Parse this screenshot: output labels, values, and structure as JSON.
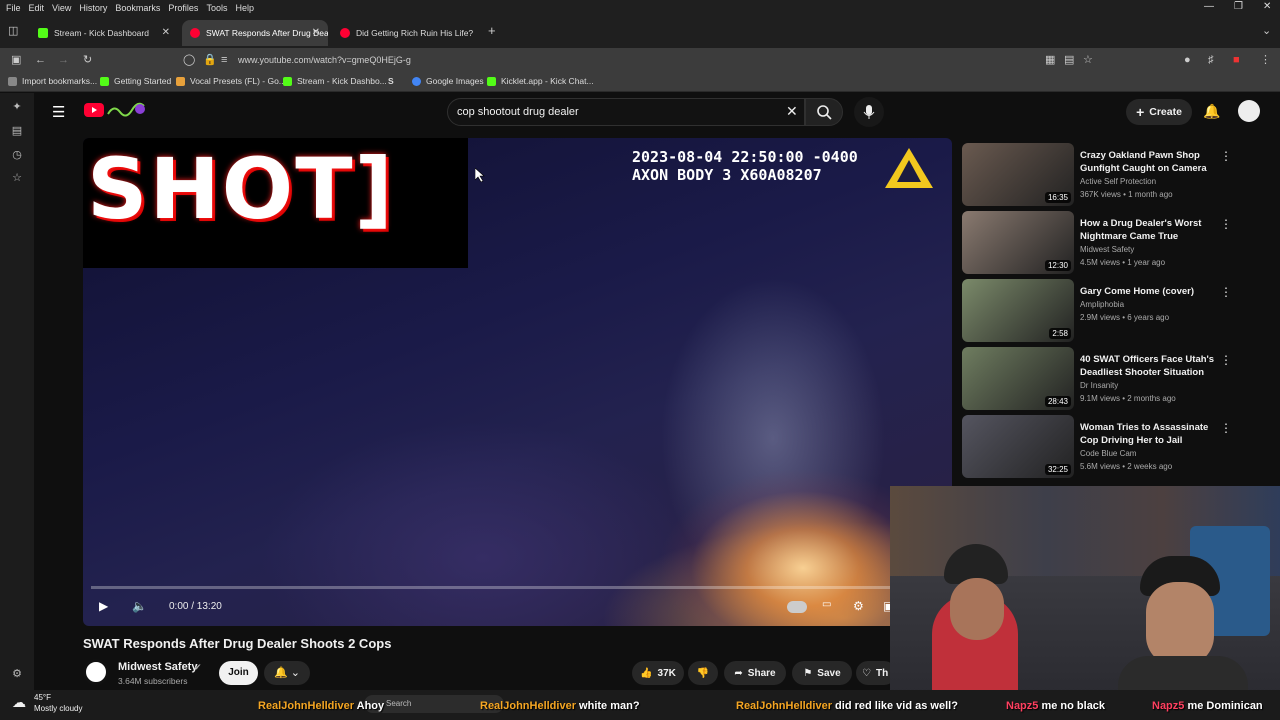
{
  "menubar": [
    "File",
    "Edit",
    "View",
    "History",
    "Bookmarks",
    "Profiles",
    "Tools",
    "Help"
  ],
  "tabs": [
    {
      "label": "Stream - Kick Dashboard",
      "color": "#53fc18"
    },
    {
      "label": "SWAT Responds After Drug Dea",
      "color": "#ff0033"
    },
    {
      "label": "Did Getting Rich Ruin His Life?",
      "color": "#ff0033"
    }
  ],
  "address": {
    "url": "www.youtube.com/watch?v=gmeQ0HEjG-g"
  },
  "bookmarks": [
    {
      "label": "Import bookmarks...",
      "color": "#888"
    },
    {
      "label": "Getting Started",
      "color": "#53fc18"
    },
    {
      "label": "Vocal Presets (FL) - Go...",
      "color": "#e8a13b"
    },
    {
      "label": "Stream - Kick Dashbo...",
      "color": "#53fc18"
    },
    {
      "label": "S",
      "color": "#555"
    },
    {
      "label": "Google Images",
      "color": "#4285f4"
    },
    {
      "label": "Kicklet.app - Kick Chat...",
      "color": "#53fc18"
    }
  ],
  "search": {
    "query": "cop shootout drug dealer"
  },
  "header": {
    "create_label": "Create"
  },
  "video": {
    "overlay_text": "SHOT]",
    "timestamp_line1": "2023-08-04 22:50:00 -0400",
    "timestamp_line2": "AXON BODY 3 X60A08207",
    "time": "0:00 / 13:20",
    "progress": 0.0
  },
  "title": "SWAT Responds After Drug Dealer Shoots 2 Cops",
  "channel": {
    "name": "Midwest Safety",
    "subs": "3.64M subscribers",
    "join_label": "Join"
  },
  "actions": {
    "likes": "37K",
    "share": "Share",
    "save": "Save",
    "thanks": "Th"
  },
  "recommendations": [
    {
      "title": "Crazy Oakland Pawn Shop Gunfight Caught on Camera",
      "channel": "Active Self Protection",
      "meta": "367K views • 1 month ago",
      "duration": "16:35",
      "thumb_color": "#6a5a50"
    },
    {
      "title": "How a Drug Dealer's Worst Nightmare Came True",
      "channel": "Midwest Safety",
      "meta": "4.5M views • 1 year ago",
      "duration": "12:30",
      "thumb_color": "#8a7a70"
    },
    {
      "title": "Gary Come Home (cover)",
      "channel": "Ampliphobia",
      "meta": "2.9M views • 6 years ago",
      "duration": "2:58",
      "thumb_color": "#7b8a6a"
    },
    {
      "title": "40 SWAT Officers Face Utah's Deadliest Shooter Situation",
      "channel": "Dr Insanity",
      "meta": "9.1M views • 2 months ago",
      "duration": "28:43",
      "thumb_color": "#6f7d60"
    },
    {
      "title": "Woman Tries to Assassinate Cop Driving Her to Jail",
      "channel": "Code Blue Cam",
      "meta": "5.6M views • 2 weeks ago",
      "duration": "32:25",
      "thumb_color": "#555560"
    }
  ],
  "weather": {
    "temp": "45°F",
    "desc": "Mostly cloudy"
  },
  "taskbar": {
    "search_label": "Search"
  },
  "chat": [
    {
      "user": "RealJohnHelldiver",
      "message": "Ahoy",
      "color": "#f5a623"
    },
    {
      "user": "RealJohnHelldiver",
      "message": "white man?",
      "color": "#f5a623"
    },
    {
      "user": "RealJohnHelldiver",
      "message": "did red like vid as well?",
      "color": "#f5a623"
    },
    {
      "user": "Napz5",
      "message": "me no black",
      "color": "#ff4060"
    },
    {
      "user": "Napz5",
      "message": "me Dominican",
      "color": "#ff4060"
    }
  ]
}
